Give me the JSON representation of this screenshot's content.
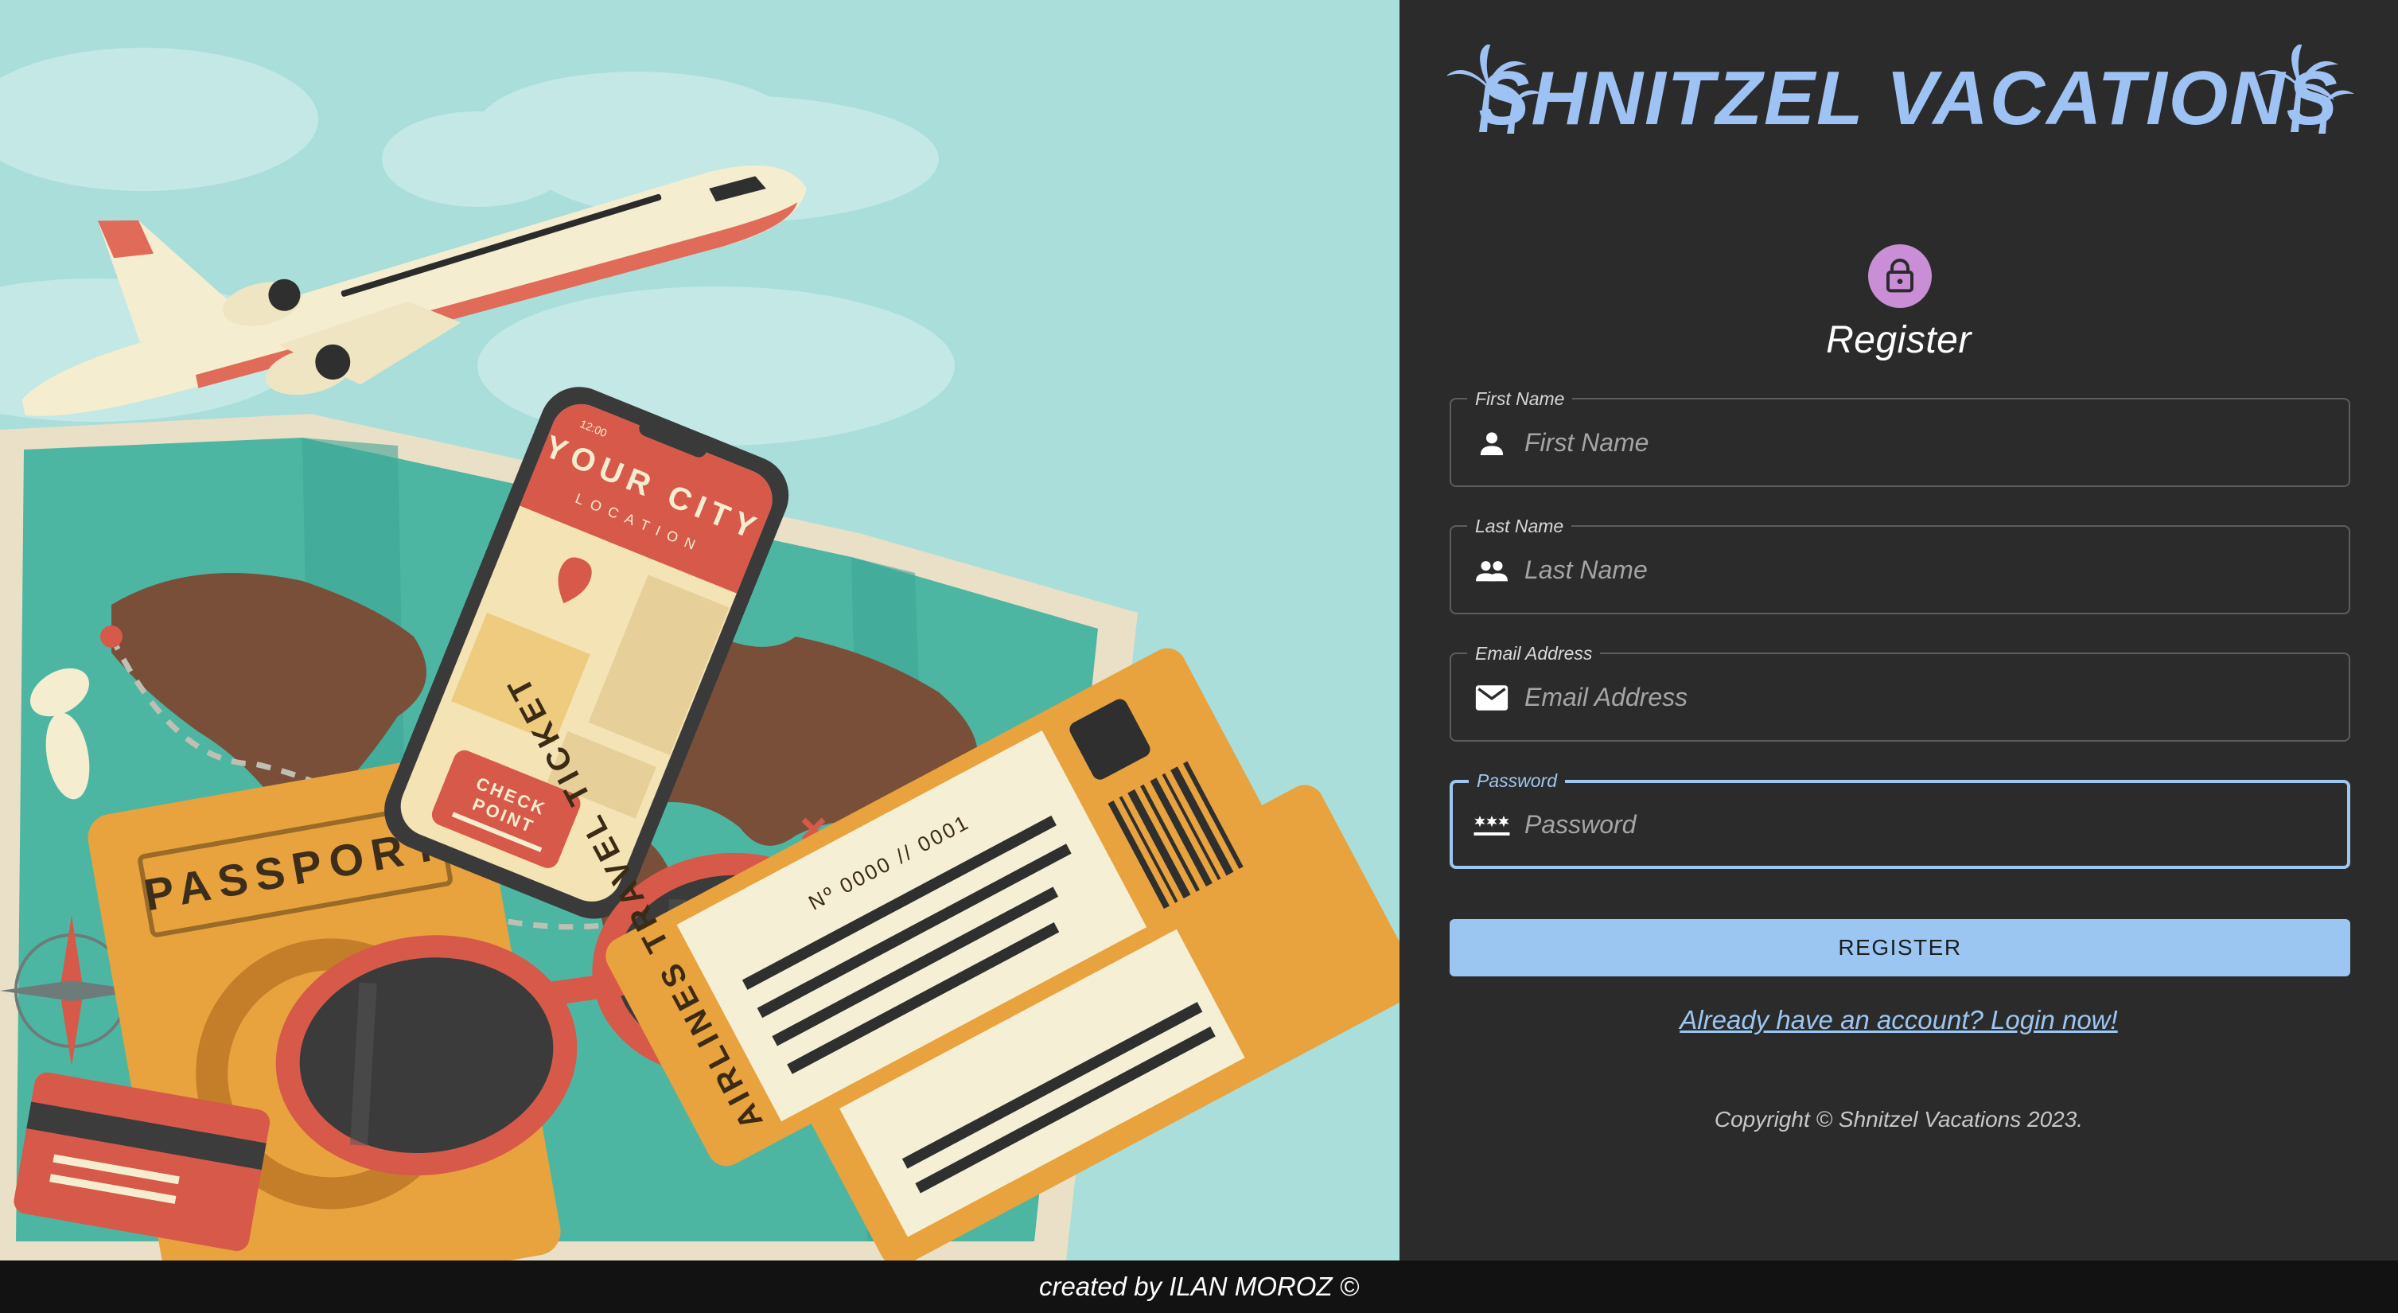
{
  "brand": {
    "name": "SHNITZEL VACATIONS",
    "color": "#9ec2f3",
    "left_icon": "palm-trees-icon",
    "right_icon": "palm-trees-icon"
  },
  "hero": {
    "phone_title": "YOUR CITY",
    "phone_subtitle": "LOCATION",
    "phone_time": "12:00",
    "check_point": [
      "CHECK",
      "POINT"
    ],
    "passport": "PASSPORT",
    "ticket_title": "AIRLINES TRAVEL TICKET",
    "ticket_number": "Nº 0000 // 0001"
  },
  "form": {
    "avatar_icon": "lock-icon",
    "avatar_color": "#c98ed6",
    "title": "Register",
    "fields": [
      {
        "label": "First Name",
        "placeholder": "First Name",
        "icon": "person-icon"
      },
      {
        "label": "Last Name",
        "placeholder": "Last Name",
        "icon": "people-icon"
      },
      {
        "label": "Email Address",
        "placeholder": "Email Address",
        "icon": "email-icon"
      },
      {
        "label": "Password",
        "placeholder": "Password",
        "icon": "password-icon",
        "focused": true
      }
    ],
    "submit_label": "REGISTER",
    "login_link": "Already have an account? Login now!",
    "copyright": "Copyright © Shnitzel Vacations 2023.",
    "accent": "#9cc6f2"
  },
  "footer": {
    "credit": "created by ILAN MOROZ ©"
  }
}
